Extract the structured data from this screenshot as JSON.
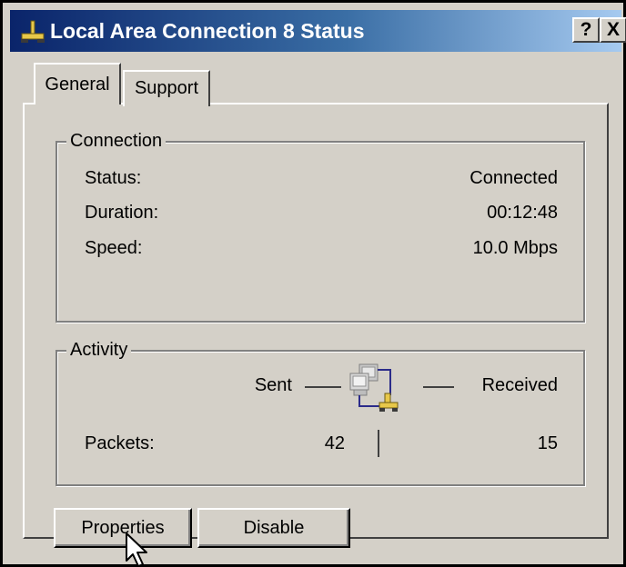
{
  "window": {
    "title": "Local Area Connection 8 Status",
    "help_button": "?",
    "close_button": "X"
  },
  "tabs": [
    {
      "label": "General",
      "active": true
    },
    {
      "label": "Support",
      "active": false
    }
  ],
  "connection": {
    "legend": "Connection",
    "rows": [
      {
        "label": "Status:",
        "value": "Connected"
      },
      {
        "label": "Duration:",
        "value": "00:12:48"
      },
      {
        "label": "Speed:",
        "value": "10.0 Mbps"
      }
    ]
  },
  "activity": {
    "legend": "Activity",
    "sent_label": "Sent",
    "received_label": "Received",
    "packets_label": "Packets:",
    "packets_sent": "42",
    "packets_received": "15",
    "icon": "network-computers-icon"
  },
  "buttons": {
    "properties": "Properties",
    "disable": "Disable"
  },
  "colors": {
    "titlebar_start": "#0a246a",
    "titlebar_end": "#a6caf0",
    "dialog_face": "#d4d0c8"
  }
}
